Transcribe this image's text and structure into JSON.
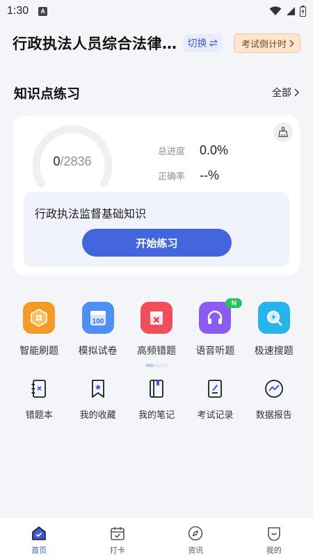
{
  "status_bar": {
    "time": "1:30",
    "notification_icon_letter": "A",
    "icons": [
      "wifi-icon",
      "signal-icon",
      "battery-icon"
    ]
  },
  "header": {
    "title": "行政执法人员综合法律…",
    "switch_label": "切换",
    "countdown_label": "考试倒计时"
  },
  "section": {
    "title": "知识点练习",
    "all_label": "全部"
  },
  "progress_card": {
    "done": "0",
    "total": "/2836",
    "progress_fraction": 0.0,
    "stats": [
      {
        "label": "总进度",
        "value": "0.0%"
      },
      {
        "label": "正确率",
        "value": "--%"
      }
    ],
    "topic": "行政执法监督基础知识",
    "start_label": "开始练习"
  },
  "features": [
    {
      "icon": "smart-practice-icon",
      "label": "智能刷题"
    },
    {
      "icon": "mock-exam-icon",
      "label": "模拟试卷"
    },
    {
      "icon": "frequent-mistakes-icon",
      "label": "高频错题"
    },
    {
      "icon": "audio-questions-icon",
      "label": "语音听题",
      "badge": "N"
    },
    {
      "icon": "quick-search-icon",
      "label": "极速搜题"
    }
  ],
  "tools": [
    {
      "icon": "mistake-book-icon",
      "label": "错题本"
    },
    {
      "icon": "bookmark-icon",
      "label": "我的收藏"
    },
    {
      "icon": "notebook-icon",
      "label": "我的笔记"
    },
    {
      "icon": "exam-record-icon",
      "label": "考试记录"
    },
    {
      "icon": "data-report-icon",
      "label": "数据报告"
    }
  ],
  "bottom_nav": [
    {
      "icon": "home-icon",
      "label": "首页",
      "active": true
    },
    {
      "icon": "calendar-check-icon",
      "label": "打卡",
      "active": false
    },
    {
      "icon": "compass-icon",
      "label": "资讯",
      "active": false
    },
    {
      "icon": "profile-icon",
      "label": "我的",
      "active": false
    }
  ],
  "colors": {
    "accent": "#4466dd",
    "background": "#f4f5f9",
    "countdown_bg": "#fde5cf"
  }
}
